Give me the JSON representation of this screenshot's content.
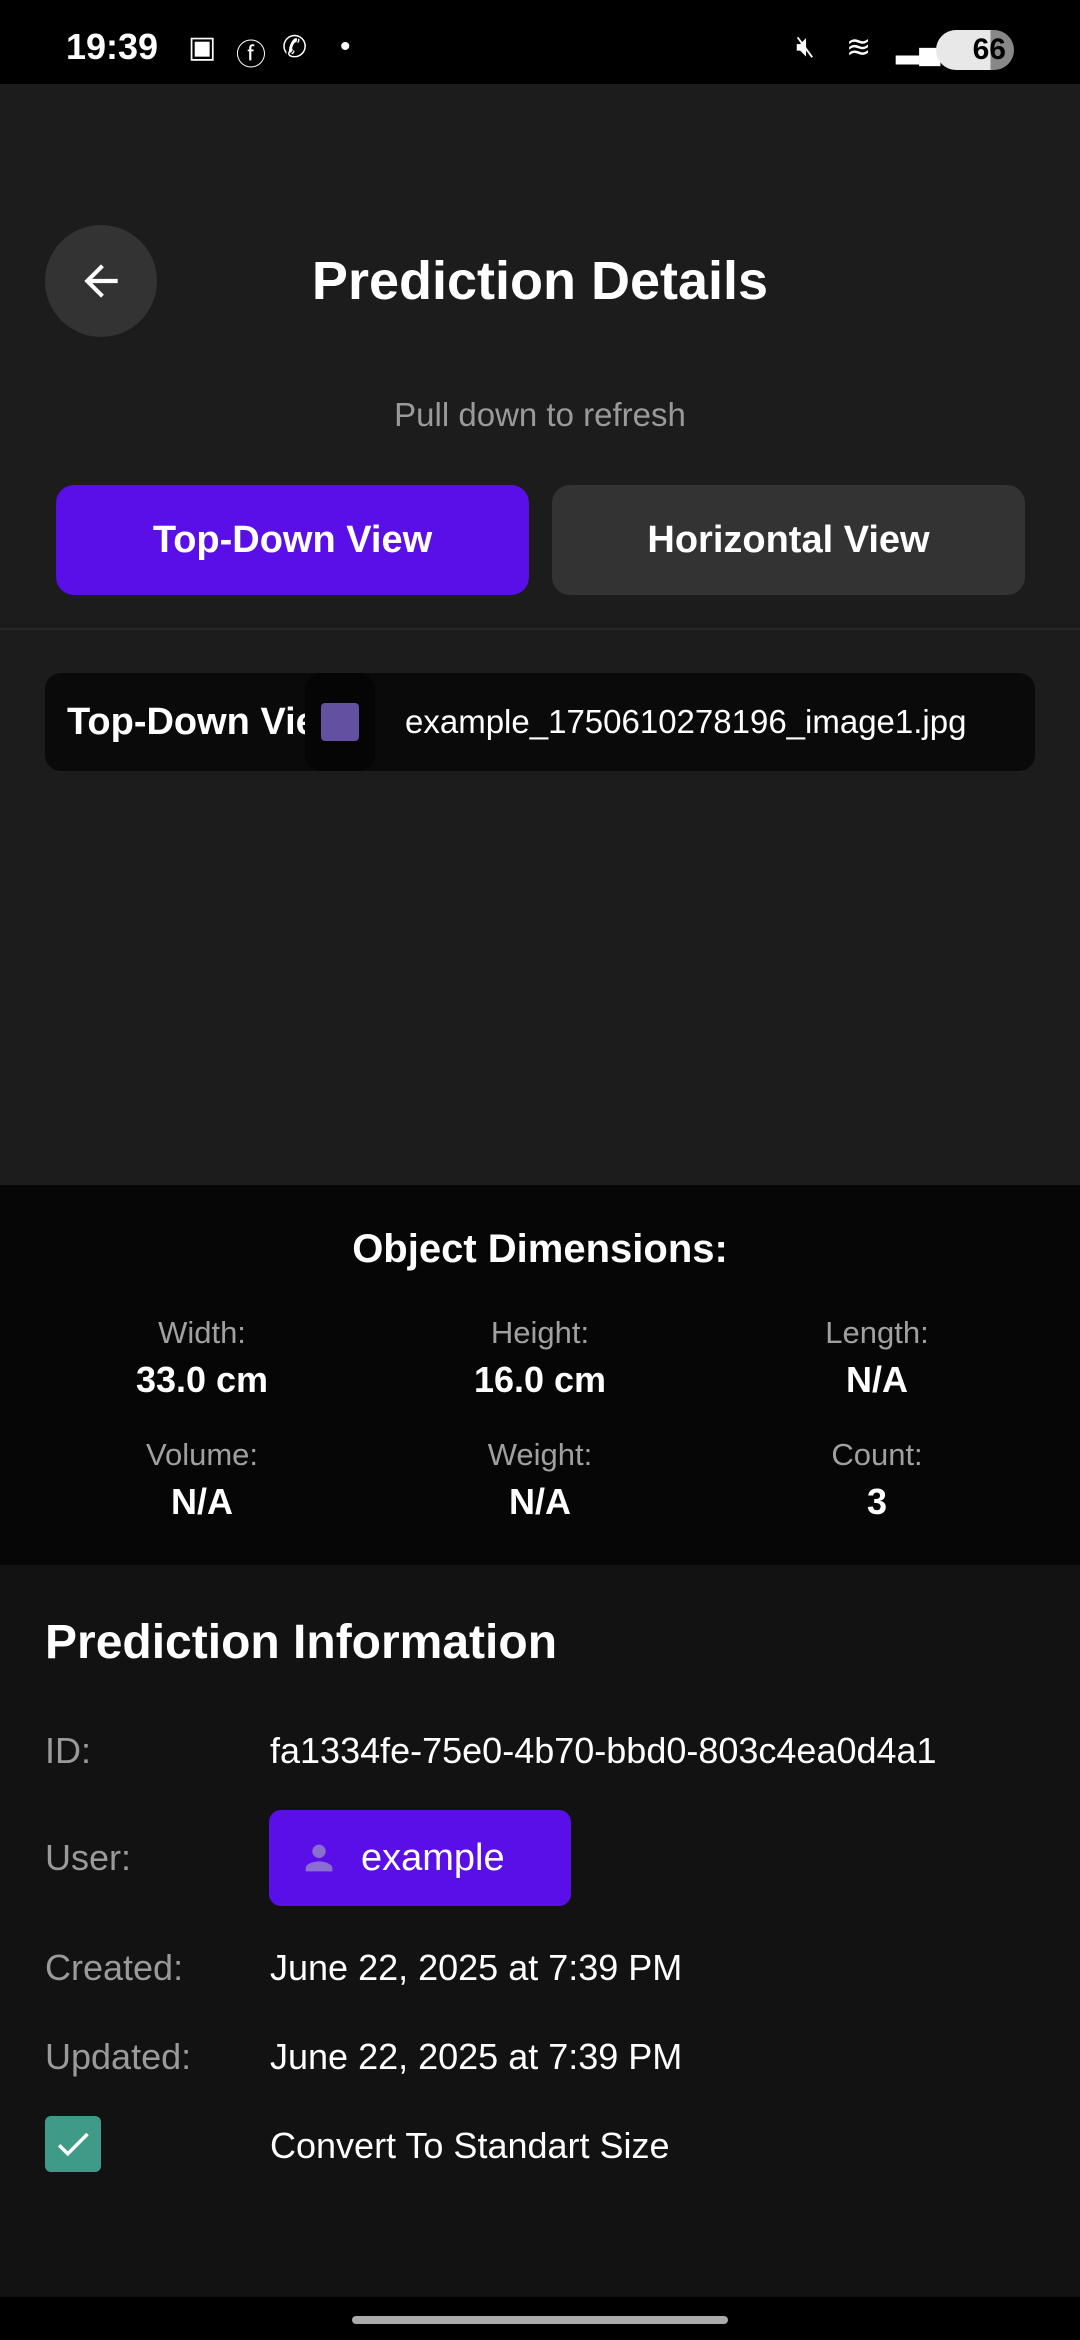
{
  "status_bar": {
    "time": "19:39",
    "battery": "66"
  },
  "header": {
    "title": "Prediction Details",
    "hint": "Pull down to refresh"
  },
  "tabs": [
    {
      "label": "Top-Down View",
      "active": true
    },
    {
      "label": "Horizontal View",
      "active": false
    }
  ],
  "image_row": {
    "label": "Top-Down View",
    "filename": "example_1750610278196_image1.jpg"
  },
  "dimensions": {
    "title": "Object Dimensions:",
    "items": [
      {
        "label": "Width:",
        "value": "33.0 cm"
      },
      {
        "label": "Height:",
        "value": "16.0 cm"
      },
      {
        "label": "Length:",
        "value": "N/A"
      },
      {
        "label": "Volume:",
        "value": "N/A"
      },
      {
        "label": "Weight:",
        "value": "N/A"
      },
      {
        "label": "Count:",
        "value": "3"
      }
    ]
  },
  "info": {
    "title": "Prediction Information",
    "id_label": "ID:",
    "id": "fa1334fe-75e0-4b70-bbd0-803c4ea0d4a1",
    "user_label": "User:",
    "user": "example",
    "created_label": "Created:",
    "created": "June 22, 2025 at 7:39 PM",
    "updated_label": "Updated:",
    "updated": "June 22, 2025 at 7:39 PM",
    "convert_label": "Convert To Standart Size",
    "convert_checked": true
  }
}
